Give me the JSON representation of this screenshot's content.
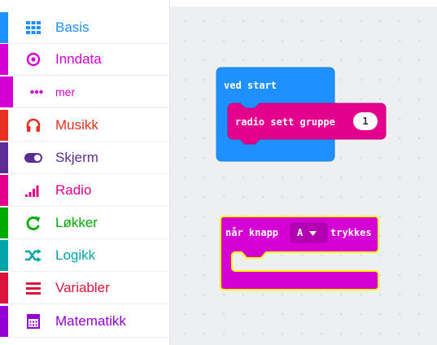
{
  "toolbox": {
    "categories": [
      {
        "label": "Basis",
        "color": "#1e90ff",
        "icon": "grid-icon"
      },
      {
        "label": "Inndata",
        "color": "#d400d4",
        "icon": "target-icon"
      },
      {
        "label": "mer",
        "color": "#d400d4",
        "icon": "ellipsis-icon"
      },
      {
        "label": "Musikk",
        "color": "#e63022",
        "icon": "headphones-icon"
      },
      {
        "label": "Skjerm",
        "color": "#5c2d91",
        "icon": "toggle-icon"
      },
      {
        "label": "Radio",
        "color": "#e3008c",
        "icon": "signal-bars-icon"
      },
      {
        "label": "Løkker",
        "color": "#00aa00",
        "icon": "refresh-icon"
      },
      {
        "label": "Logikk",
        "color": "#00a4a6",
        "icon": "shuffle-icon"
      },
      {
        "label": "Variabler",
        "color": "#dc143c",
        "icon": "list-icon"
      },
      {
        "label": "Matematikk",
        "color": "#9400d3",
        "icon": "calculator-icon"
      }
    ]
  },
  "blocks": {
    "on_start": {
      "label": "ved start",
      "color": "#1e90ff"
    },
    "radio_group": {
      "label": "radio sett gruppe",
      "value": "1",
      "color": "#e3008c"
    },
    "button_event": {
      "prefix": "når knapp",
      "button": "A",
      "suffix": "trykkes",
      "color": "#d400d4",
      "outline": "#ffff00"
    }
  }
}
